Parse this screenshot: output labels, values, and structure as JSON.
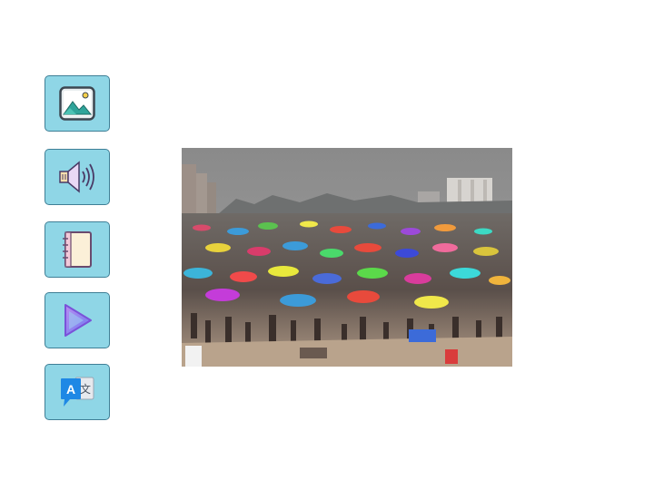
{
  "toolbar": {
    "buttons": [
      {
        "name": "image-button",
        "icon": "image-icon"
      },
      {
        "name": "audio-button",
        "icon": "speaker-icon"
      },
      {
        "name": "notebook-button",
        "icon": "notebook-icon"
      },
      {
        "name": "play-button",
        "icon": "play-icon"
      },
      {
        "name": "translate-button",
        "icon": "translate-icon",
        "glyph_latin": "A",
        "glyph_cjk": "文"
      }
    ],
    "colors": {
      "button_fill": "#8fd6e6",
      "button_border": "#3f7f96"
    }
  },
  "main": {
    "image": {
      "subject": "crowded-beach-photo",
      "colors": {
        "sky": "#8f8f8f",
        "sand": "#b9a38c"
      }
    }
  }
}
